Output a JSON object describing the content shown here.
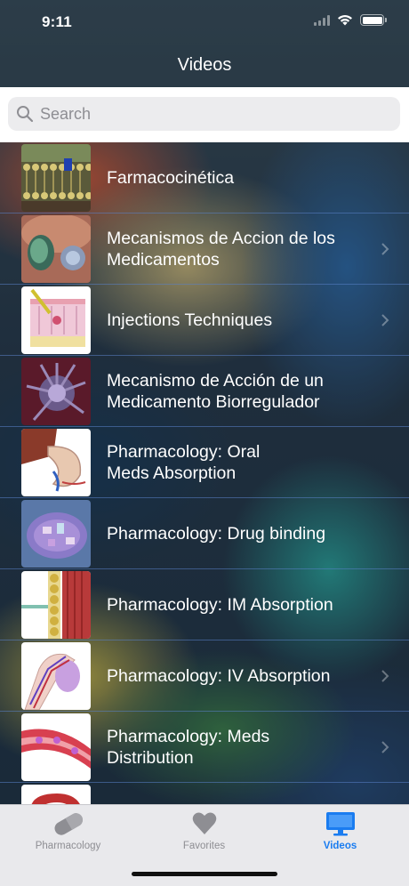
{
  "status_bar": {
    "time": "9:11"
  },
  "nav": {
    "title": "Videos"
  },
  "search": {
    "placeholder": "Search"
  },
  "videos": [
    {
      "title": "Farmacocinética",
      "thumb": "membrane"
    },
    {
      "title": "Mecanismos de Accion de los\nMedicamentos",
      "thumb": "cells"
    },
    {
      "title": "Injections Techniques",
      "thumb": "skin"
    },
    {
      "title": "Mecanismo de Acción de un\nMedicamento Biorregulador",
      "thumb": "spiky"
    },
    {
      "title": "Pharmacology: Oral\nMeds Absorption",
      "thumb": "stomach"
    },
    {
      "title": "Pharmacology: Drug binding",
      "thumb": "cell"
    },
    {
      "title": "Pharmacology: IM Absorption",
      "thumb": "muscle"
    },
    {
      "title": "Pharmacology: IV Absorption",
      "thumb": "arm"
    },
    {
      "title": "Pharmacology: Meds\nDistribution",
      "thumb": "vessel"
    },
    {
      "title": "",
      "thumb": "nephron"
    }
  ],
  "tabs": [
    {
      "label": "Pharmacology",
      "icon": "pill-icon",
      "active": false
    },
    {
      "label": "Favorites",
      "icon": "heart-icon",
      "active": false
    },
    {
      "label": "Videos",
      "icon": "monitor-icon",
      "active": true
    }
  ],
  "colors": {
    "accent": "#1a7cf0",
    "tab_inactive": "#8e8e93",
    "row_separator": "#5a82c8"
  }
}
